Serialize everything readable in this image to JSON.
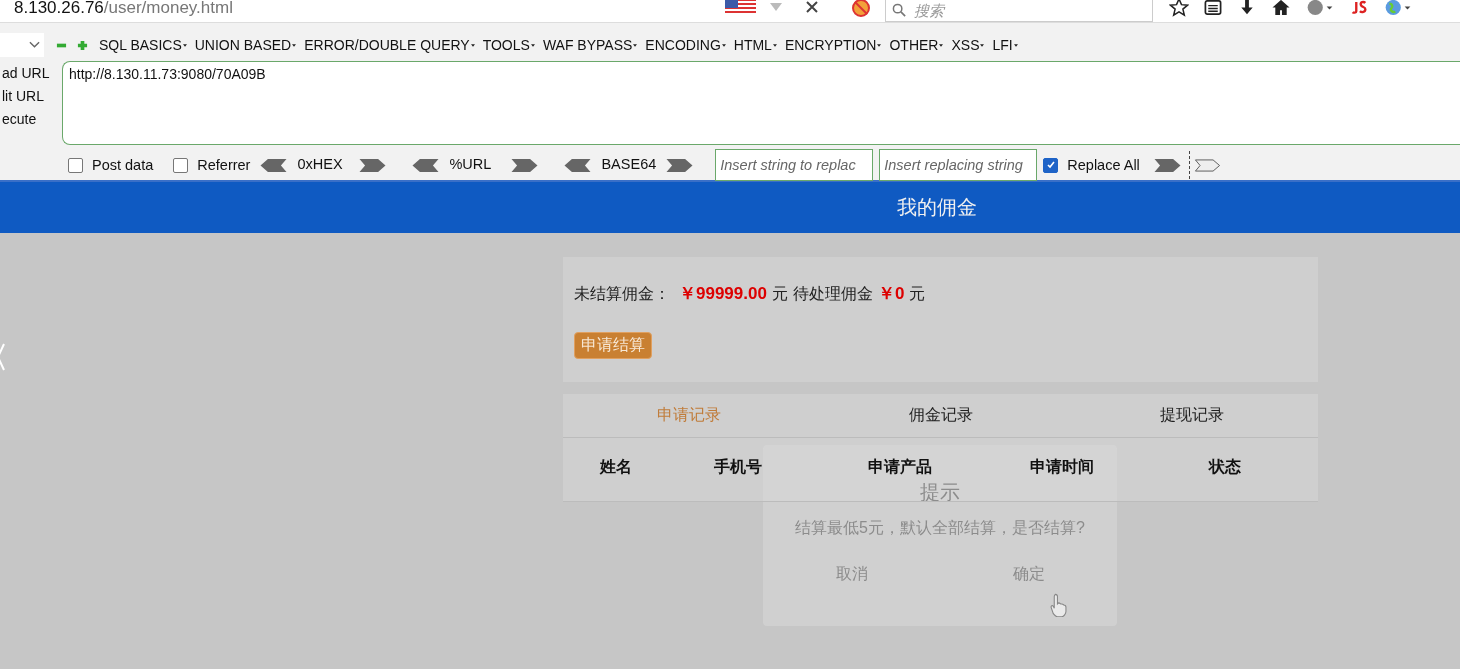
{
  "browser": {
    "address": {
      "host": "8.130.26.76",
      "path": "/user/money.html"
    },
    "search": {
      "placeholder": "搜索"
    }
  },
  "hackbar": {
    "menus": [
      "SQL BASICS",
      "UNION BASED",
      "ERROR/DOUBLE QUERY",
      "TOOLS",
      "WAF BYPASS",
      "ENCODING",
      "HTML",
      "ENCRYPTION",
      "OTHER",
      "XSS",
      "LFI"
    ],
    "side_labels": [
      "ad URL",
      "lit URL",
      "ecute"
    ],
    "url": "http://8.130.11.73:9080/70A09B",
    "options": [
      {
        "label": "Post data",
        "checked": false
      },
      {
        "label": "Referrer",
        "checked": false
      }
    ],
    "encoders": [
      "0xHEX",
      "%URL",
      "BASE64"
    ],
    "find_placeholder": "Insert string to replac",
    "replace_placeholder": "Insert replacing string",
    "replace_all": {
      "label": "Replace All",
      "checked": true
    }
  },
  "page": {
    "title": "我的佣金",
    "summary": {
      "unsettled_label": "未结算佣金：",
      "unsettled_amount": "￥99999.00",
      "unsettled_unit": "元",
      "pending_label": "待处理佣金",
      "pending_amount": "￥0",
      "pending_unit": "元"
    },
    "apply_button": "申请结算",
    "tabs": [
      {
        "label": "申请记录",
        "selected": true
      },
      {
        "label": "佣金记录",
        "selected": false
      },
      {
        "label": "提现记录",
        "selected": false
      }
    ],
    "columns": [
      "姓名",
      "手机号",
      "申请产品",
      "申请时间",
      "状态"
    ]
  },
  "dialog": {
    "title": "提示",
    "message": "结算最低5元，默认全部结算，是否结算?",
    "buttons": [
      "取消",
      "确定"
    ]
  }
}
